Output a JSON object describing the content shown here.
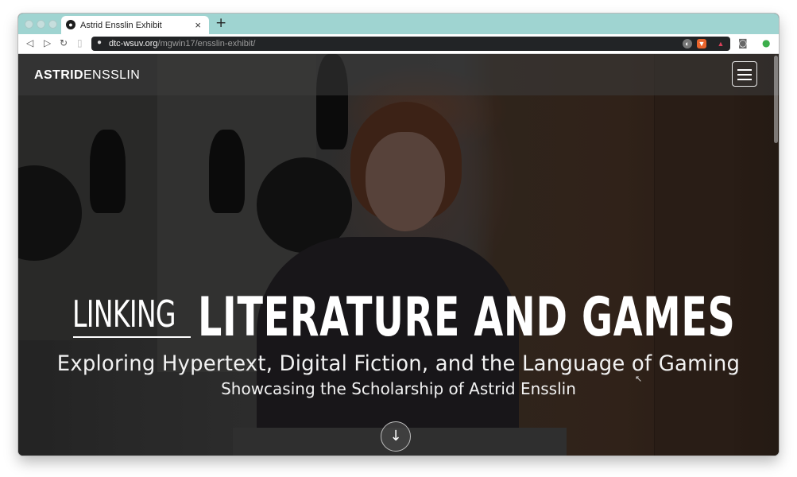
{
  "browser": {
    "tab_title": "Astrid Ensslin Exhibit",
    "tab_close": "×",
    "new_tab": "+",
    "url_domain": "dtc-wsuv.org",
    "url_path": "/mgwin17/ensslin-exhibit/",
    "back": "◁",
    "forward": "▷",
    "reload": "↻",
    "lock": "🔒"
  },
  "site": {
    "brand_bold": "ASTRID",
    "brand_light": "ENSSLIN"
  },
  "hero": {
    "title_small": "LINKING",
    "title_large": "LITERATURE AND GAMES",
    "subtitle": "Exploring Hypertext, Digital Fiction, and the Language of Gaming",
    "tagline": "Showcasing the Scholarship of Astrid Ensslin",
    "scroll_arrow": "↓"
  },
  "icons": {
    "favicon": "globe-icon",
    "menu": "hamburger-icon",
    "down": "arrow-down-icon"
  },
  "colors": {
    "tab_strip": "#9fd4d1",
    "url_bar": "#222426",
    "nav_overlay": "#3c3c3c"
  }
}
